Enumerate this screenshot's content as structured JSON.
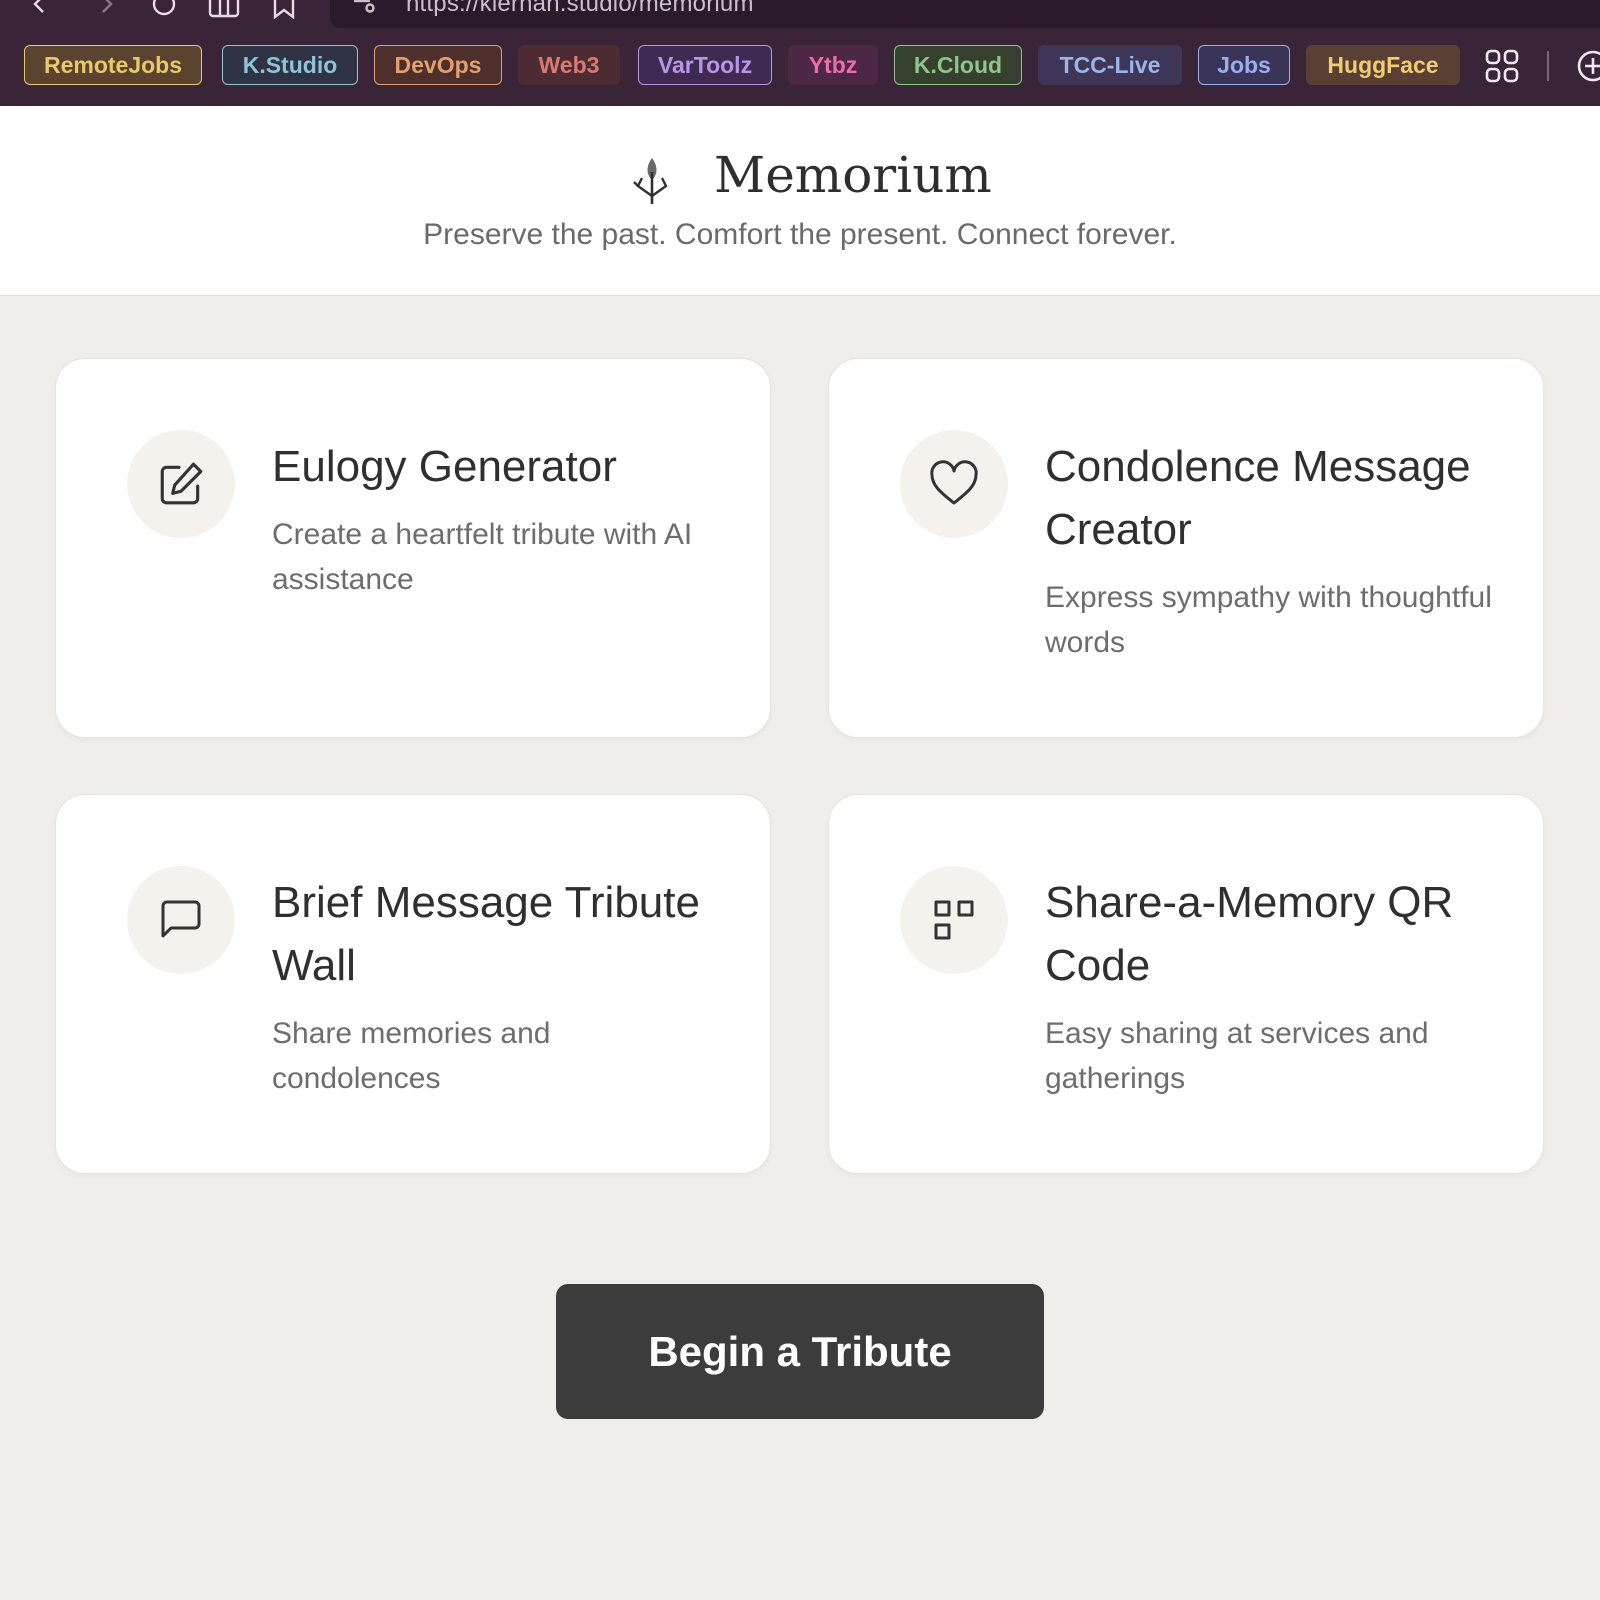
{
  "browser": {
    "url": "https://kiernan.studio/memorium",
    "bookmarks": [
      {
        "label": "RemoteJobs",
        "color": "#e8c86a",
        "bg": "#5a4430",
        "style": "outline"
      },
      {
        "label": "K.Studio",
        "color": "#8fc3d8",
        "bg": "#2f3344",
        "style": "outline"
      },
      {
        "label": "DevOps",
        "color": "#e3a06e",
        "bg": "#4d302c",
        "style": "outline"
      },
      {
        "label": "Web3",
        "color": "#d97a72",
        "bg": "#4d2b33",
        "style": "fill"
      },
      {
        "label": "VarToolz",
        "color": "#b896e6",
        "bg": "#3f2a52",
        "style": "outline"
      },
      {
        "label": "Ytbz",
        "color": "#ea6fa4",
        "bg": "#4e2745",
        "style": "fill"
      },
      {
        "label": "K.Cloud",
        "color": "#8fc48a",
        "bg": "#36402f",
        "style": "outline"
      },
      {
        "label": "TCC-Live",
        "color": "#9cb4e8",
        "bg": "#3e3656",
        "style": "fill"
      },
      {
        "label": "Jobs",
        "color": "#98aef0",
        "bg": "#3a3556",
        "style": "outline"
      },
      {
        "label": "HuggFace",
        "color": "#f1cd72",
        "bg": "#5a3f35",
        "style": "fill"
      }
    ]
  },
  "header": {
    "brand": "Memorium",
    "tagline": "Preserve the past. Comfort the present. Connect forever."
  },
  "cards": [
    {
      "icon": "edit-icon",
      "title": "Eulogy Generator",
      "description": "Create a heartfelt tribute with AI assistance"
    },
    {
      "icon": "heart-icon",
      "title": "Condolence Message Creator",
      "description": "Express sympathy with thoughtful words"
    },
    {
      "icon": "message-icon",
      "title": "Brief Message Tribute Wall",
      "description": "Share memories and condolences"
    },
    {
      "icon": "qr-code-icon",
      "title": "Share-a-Memory QR Code",
      "description": "Easy sharing at services and gatherings"
    }
  ],
  "cta": {
    "label": "Begin a Tribute"
  }
}
